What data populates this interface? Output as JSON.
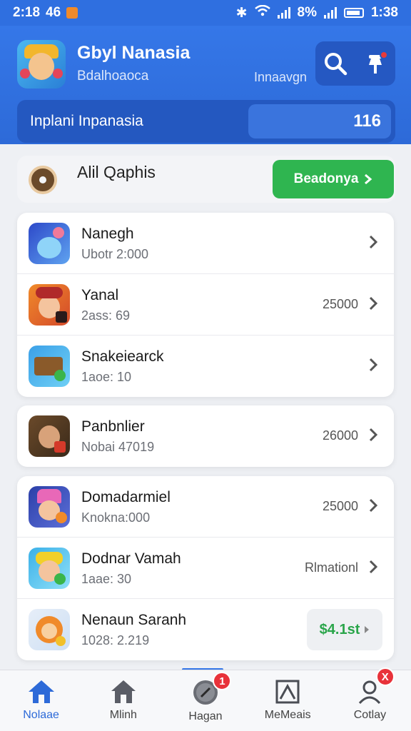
{
  "status_bar": {
    "time": "2:18",
    "network": "46",
    "battery": "8%",
    "clock": "1:38"
  },
  "header": {
    "title": "Gbyl Nanasia",
    "subtitle": "Bdalhoaoca",
    "hint": "Innaavgn",
    "balance_label": "Inplani Inpanasia",
    "balance_value": "116"
  },
  "promo": {
    "title": "Alil Qaphis",
    "button_label": "Beadonya"
  },
  "cards": [
    {
      "rows": [
        {
          "name": "Nanegh",
          "sub": "Ubotr 2:000",
          "meta": "",
          "icon": "unicorn-icon"
        },
        {
          "name": "Yanal",
          "sub": "2ass: 69",
          "meta": "25000",
          "icon": "hero-icon"
        },
        {
          "name": "Snakeiearck",
          "sub": "1aoe: 10",
          "meta": "",
          "icon": "chest-icon"
        }
      ]
    },
    {
      "rows": [
        {
          "name": "Panbnlier",
          "sub": "Nobai 47019",
          "meta": "26000",
          "icon": "warrior-icon"
        }
      ]
    },
    {
      "rows": [
        {
          "name": "Domadarmiel",
          "sub": "Knokna:000",
          "meta": "25000",
          "icon": "wizard-icon"
        },
        {
          "name": "Dodnar Vamah",
          "sub": "1aae: 30",
          "meta": "Rlmationl",
          "icon": "elf-icon"
        },
        {
          "name": "Nenaun Saranh",
          "sub": "1028: 2.219",
          "price": "$4.1st",
          "icon": "fox-icon"
        }
      ]
    }
  ],
  "nav": [
    {
      "label": "Nolaae",
      "icon": "home-icon",
      "active": true
    },
    {
      "label": "Mlinh",
      "icon": "house-icon"
    },
    {
      "label": "Hagan",
      "icon": "compass-icon",
      "badge": "1"
    },
    {
      "label": "MeMeais",
      "icon": "frame-icon"
    },
    {
      "label": "Cotlay",
      "icon": "profile-icon",
      "badge": "X"
    }
  ],
  "colors": {
    "primary": "#2f6fe0",
    "accent_green": "#2fb550",
    "badge_red": "#e8323a"
  }
}
